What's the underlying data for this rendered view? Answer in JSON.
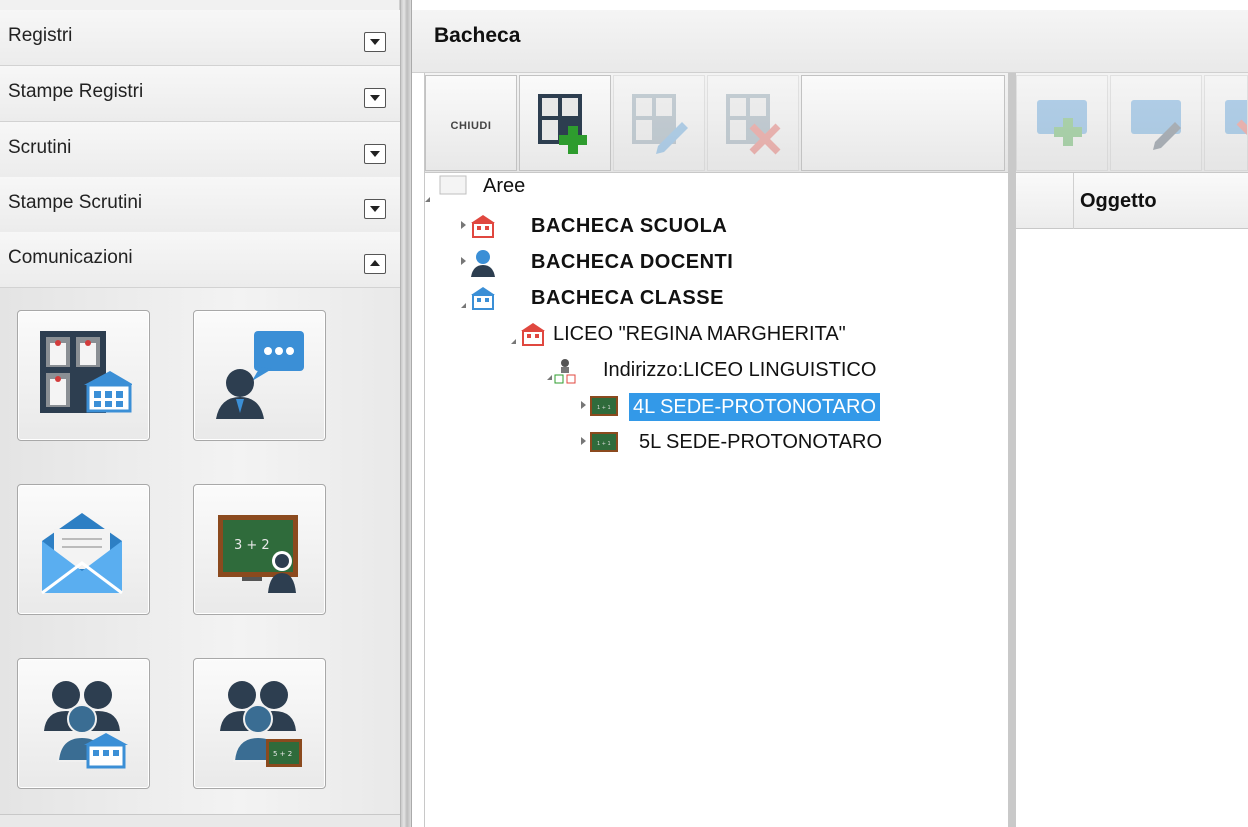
{
  "sidebar": {
    "sections": [
      {
        "label": "Registri",
        "expanded": false
      },
      {
        "label": "Stampe Registri",
        "expanded": false
      },
      {
        "label": "Scrutini",
        "expanded": false
      },
      {
        "label": "Stampe Scrutini",
        "expanded": false
      },
      {
        "label": "Comunicazioni",
        "expanded": true
      }
    ],
    "tiles": [
      {
        "icon": "bacheca-scuola-icon"
      },
      {
        "icon": "messaggi-docente-icon"
      },
      {
        "icon": "email-icon"
      },
      {
        "icon": "lavagna-docente-icon"
      },
      {
        "icon": "gruppo-scuola-icon"
      },
      {
        "icon": "gruppo-classe-icon"
      }
    ]
  },
  "main": {
    "title": "Bacheca",
    "toolbar": {
      "close_label": "CHIUDI"
    },
    "tree": {
      "root": "Aree",
      "nodes": [
        {
          "label": "BACHECA SCUOLA"
        },
        {
          "label": "BACHECA DOCENTI"
        },
        {
          "label": "BACHECA CLASSE"
        },
        {
          "label": "LICEO \"REGINA MARGHERITA\""
        },
        {
          "label": "Indirizzo:LICEO LINGUISTICO"
        },
        {
          "label": "4L SEDE-PROTONOTARO",
          "selected": true
        },
        {
          "label": "5L SEDE-PROTONOTARO"
        }
      ]
    },
    "grid": {
      "column_oggetto": "Oggetto"
    }
  },
  "colors": {
    "selection": "#3399e8",
    "accent_green": "#2e9c2e",
    "accent_blue": "#3b8fd6"
  }
}
